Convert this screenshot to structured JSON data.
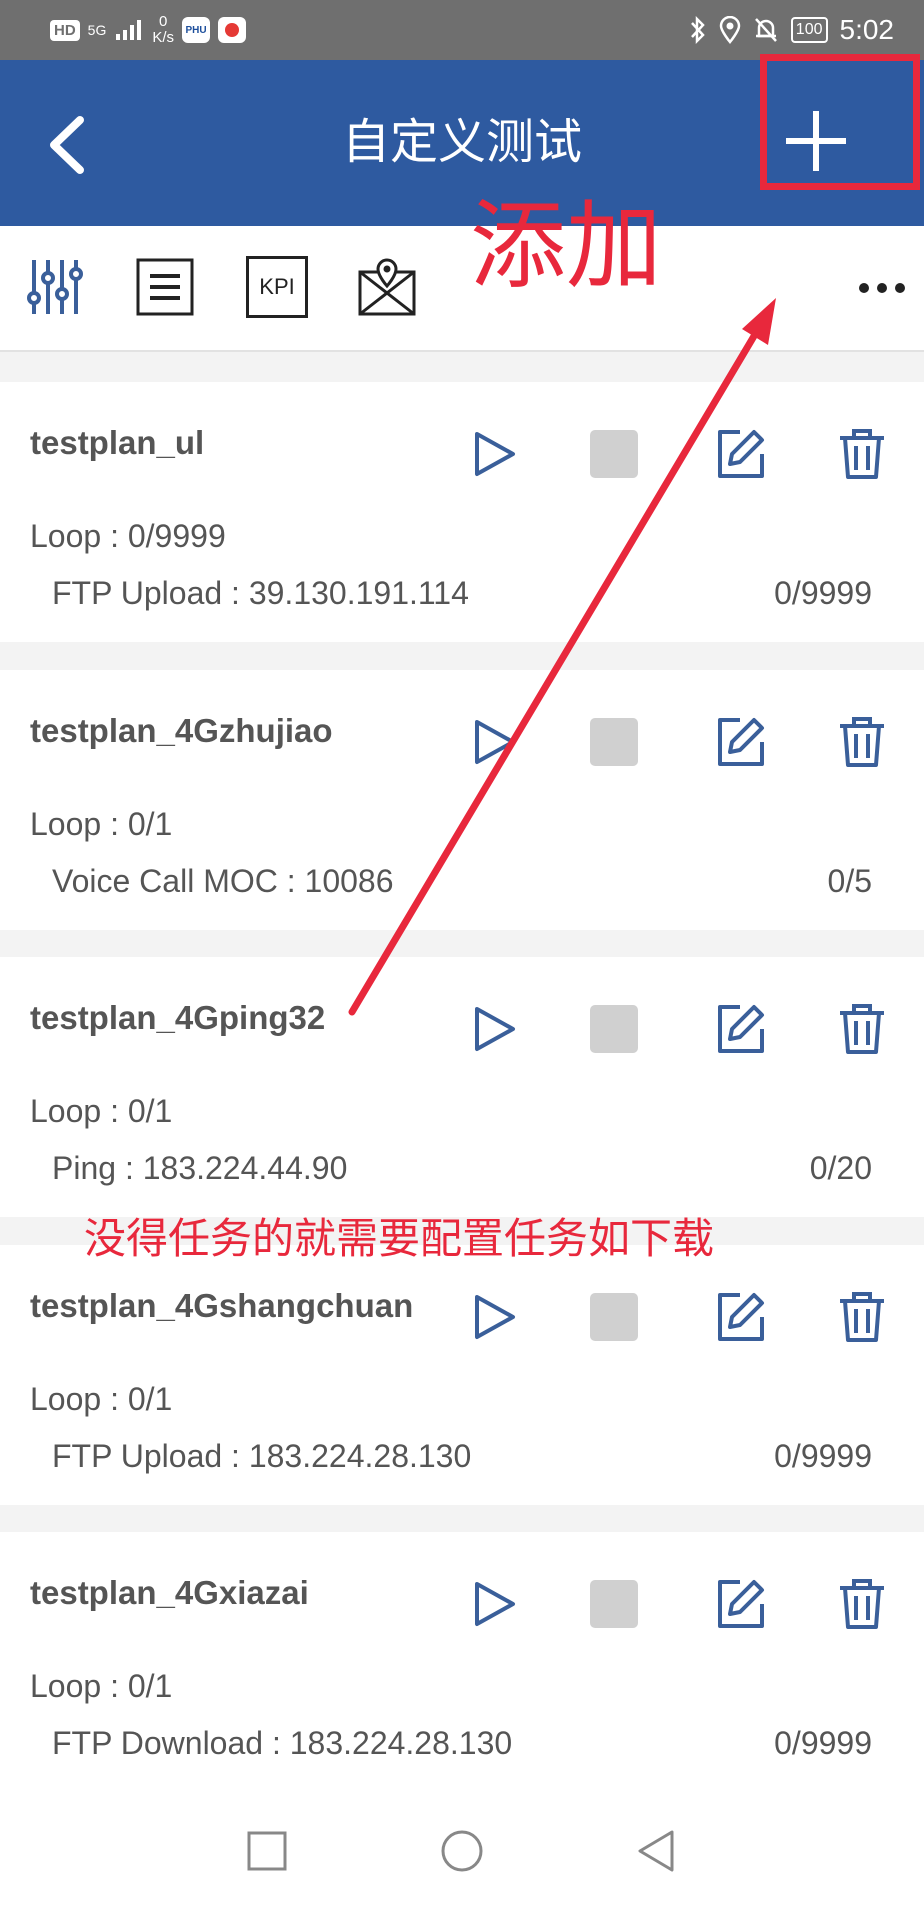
{
  "status_bar": {
    "hd": "HD",
    "signal": "5G",
    "speed_value": "0",
    "speed_unit": "K/s",
    "app_badge": "PHU",
    "battery": "100",
    "time": "5:02"
  },
  "header": {
    "title": "自定义测试"
  },
  "toolbar": {
    "kpi_label": "KPI"
  },
  "colors": {
    "header_bg": "#2e5aa0",
    "icon_blue": "#3a5f9a",
    "annotation_red": "#e8283c"
  },
  "plans": [
    {
      "name": "testplan_ul",
      "loop": "Loop : 0/9999",
      "task": "FTP Upload : 39.130.191.114",
      "task_progress": "0/9999"
    },
    {
      "name": "testplan_4Gzhujiao",
      "loop": "Loop : 0/1",
      "task": "Voice Call MOC : 10086",
      "task_progress": "0/5"
    },
    {
      "name": "testplan_4Gping32",
      "loop": "Loop : 0/1",
      "task": "Ping : 183.224.44.90",
      "task_progress": "0/20"
    },
    {
      "name": "testplan_4Gshangchuan",
      "loop": "Loop : 0/1",
      "task": "FTP Upload : 183.224.28.130",
      "task_progress": "0/9999"
    },
    {
      "name": "testplan_4Gxiazai",
      "loop": "Loop : 0/1",
      "task": "FTP Download : 183.224.28.130",
      "task_progress": "0/9999"
    }
  ],
  "annotations": {
    "add_label": "添加",
    "note": "没得任务的就需要配置任务如下载"
  }
}
